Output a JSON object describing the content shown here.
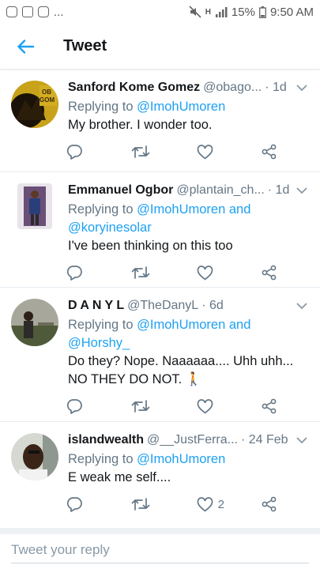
{
  "status_bar": {
    "notifications": "...",
    "network": "H",
    "battery": "15%",
    "time": "9:50 AM"
  },
  "header": {
    "title": "Tweet"
  },
  "replies": [
    {
      "name": "Sanford Kome Gomez",
      "handle": "@obago...",
      "time": "· 1d",
      "replying_prefix": "Replying to ",
      "replying_to": "@ImohUmoren",
      "replying_to_2": "",
      "text_line1": "My brother. I wonder too.",
      "text_line2": "",
      "like_count": ""
    },
    {
      "name": "Emmanuel Ogbor",
      "handle": "@plantain_ch...",
      "time": "· 1d",
      "replying_prefix": "Replying to ",
      "replying_to": "@ImohUmoren and",
      "replying_to_2": "@koryinesolar",
      "text_line1": "I've been thinking on this too",
      "text_line2": "",
      "like_count": ""
    },
    {
      "name": "D A N Y L",
      "handle": "@TheDanyL",
      "time": "· 6d",
      "replying_prefix": "Replying to ",
      "replying_to": "@ImohUmoren and",
      "replying_to_2": "@Horshy_",
      "text_line1": "Do they? Nope. Naaaaaa.... Uhh uhh...",
      "text_line2": "NO THEY DO NOT. 🚶",
      "like_count": ""
    },
    {
      "name": "islandwealth",
      "handle": "@__JustFerra...",
      "time": "· 24 Feb",
      "replying_prefix": "Replying to ",
      "replying_to": "@ImohUmoren",
      "replying_to_2": "",
      "text_line1": "E weak me self....",
      "text_line2": "",
      "like_count": "2"
    }
  ],
  "composer": {
    "placeholder": "Tweet your reply"
  },
  "colors": {
    "accent": "#1da1f2",
    "muted": "#657786",
    "divider": "#e6ecf0"
  }
}
